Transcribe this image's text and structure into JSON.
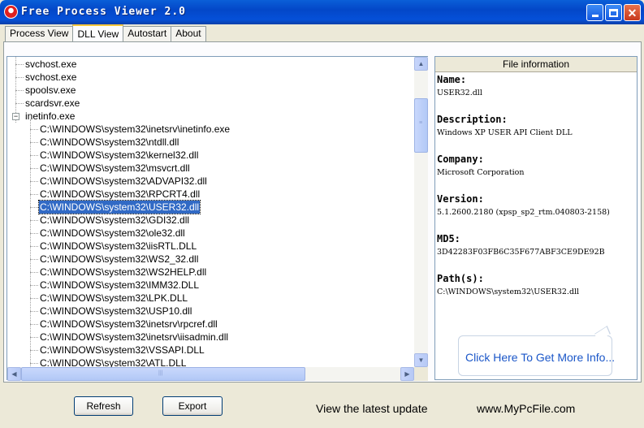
{
  "window": {
    "title": "Free Process Viewer 2.0",
    "controls": {
      "minimize": "_",
      "maximize": "□",
      "close": "✕"
    }
  },
  "tabs": [
    {
      "label": "Process View",
      "active": false
    },
    {
      "label": "DLL View",
      "active": true
    },
    {
      "label": "Autostart",
      "active": false
    },
    {
      "label": "About",
      "active": false
    }
  ],
  "tree": {
    "processes": [
      "svchost.exe",
      "svchost.exe",
      "spoolsv.exe",
      "scardsvr.exe"
    ],
    "expanded_process": "inetinfo.exe",
    "expander_symbol": "−",
    "modules": [
      "C:\\WINDOWS\\system32\\inetsrv\\inetinfo.exe",
      "C:\\WINDOWS\\system32\\ntdll.dll",
      "C:\\WINDOWS\\system32\\kernel32.dll",
      "C:\\WINDOWS\\system32\\msvcrt.dll",
      "C:\\WINDOWS\\system32\\ADVAPI32.dll",
      "C:\\WINDOWS\\system32\\RPCRT4.dll",
      "C:\\WINDOWS\\system32\\USER32.dll",
      "C:\\WINDOWS\\system32\\GDI32.dll",
      "C:\\WINDOWS\\system32\\ole32.dll",
      "C:\\WINDOWS\\system32\\iisRTL.DLL",
      "C:\\WINDOWS\\system32\\WS2_32.dll",
      "C:\\WINDOWS\\system32\\WS2HELP.dll",
      "C:\\WINDOWS\\system32\\IMM32.DLL",
      "C:\\WINDOWS\\system32\\LPK.DLL",
      "C:\\WINDOWS\\system32\\USP10.dll",
      "C:\\WINDOWS\\system32\\inetsrv\\rpcref.dll",
      "C:\\WINDOWS\\system32\\inetsrv\\iisadmin.dll",
      "C:\\WINDOWS\\system32\\VSSAPI.DLL",
      "C:\\WINDOWS\\system32\\ATL.DLL"
    ],
    "selected_index": 6,
    "scroll": {
      "up": "▲",
      "down": "▼",
      "left": "◀",
      "right": "▶",
      "grip_v": "≡",
      "grip_h": "|||"
    }
  },
  "info": {
    "header": "File information",
    "fields": [
      {
        "label": "Name:",
        "value": "USER32.dll"
      },
      {
        "label": "Description:",
        "value": "Windows XP USER API Client DLL"
      },
      {
        "label": "Company:",
        "value": "Microsoft Corporation"
      },
      {
        "label": "Version:",
        "value": "5.1.2600.2180 (xpsp_sp2_rtm.040803-2158)"
      },
      {
        "label": "MD5:",
        "value": "3D42283F03FB6C35F677ABF3CE9DE92B"
      },
      {
        "label": "Path(s):",
        "value": "C:\\WINDOWS\\system32\\USER32.dll"
      }
    ],
    "more_info_link": "Click Here To Get More Info..."
  },
  "bottom": {
    "refresh_label": "Refresh",
    "export_label": "Export",
    "update_link": "View the latest update",
    "site_link": "www.MyPcFile.com"
  },
  "colors": {
    "selection": "#316ac5",
    "link": "#1a56c8",
    "titlebar": "#0347c8"
  }
}
